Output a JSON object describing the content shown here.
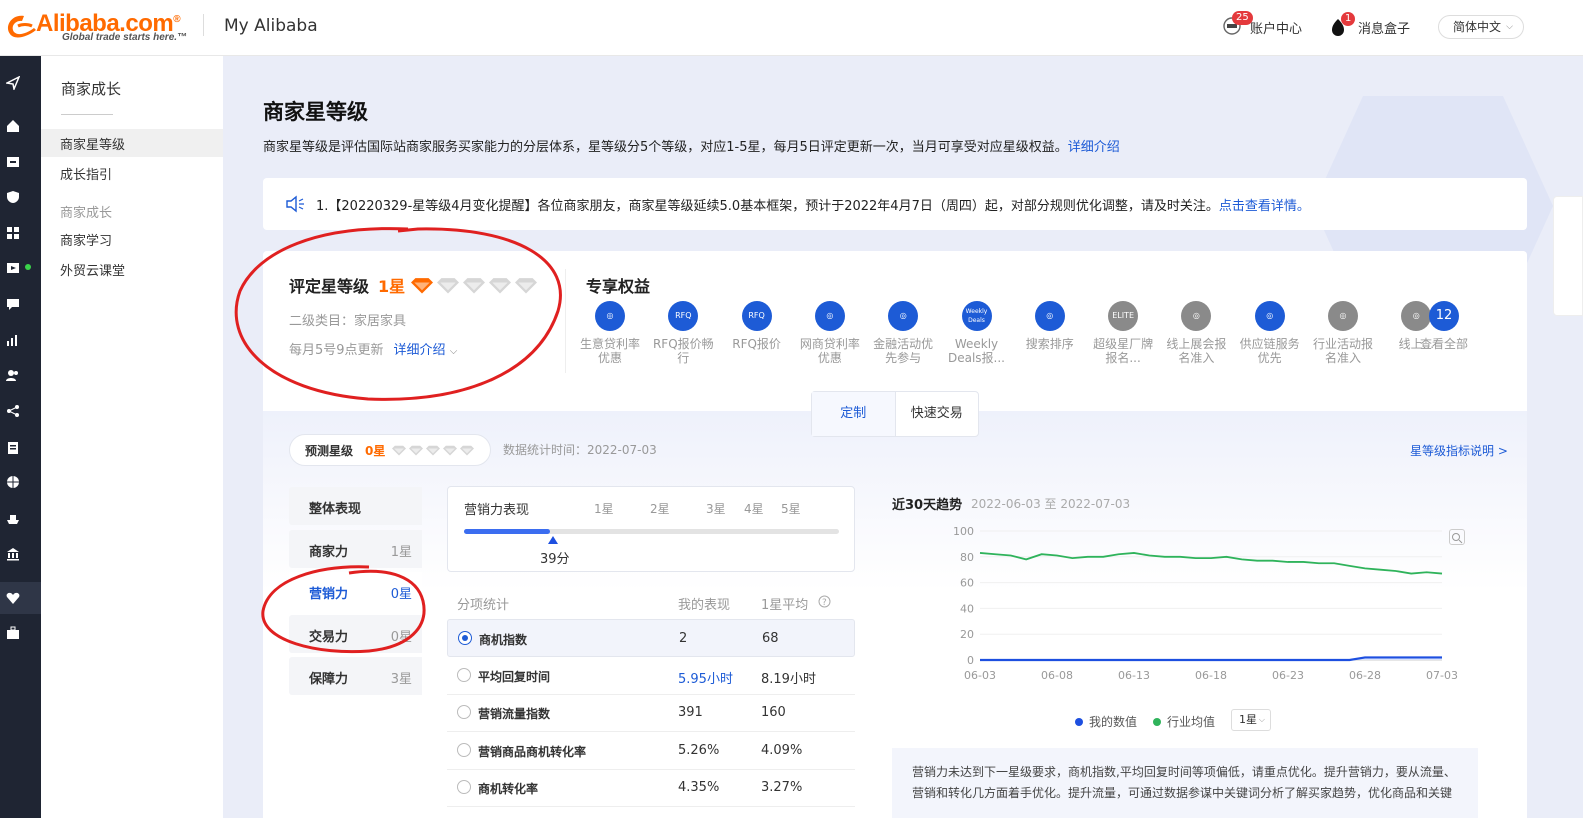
{
  "header": {
    "logo_text": "Alibaba.com",
    "logo_trademark": "®",
    "logo_tagline": "Global trade starts here.™",
    "site_title": "My Alibaba",
    "account_badge": "25",
    "account_label": "账户中心",
    "msg_badge": "1",
    "msg_label": "消息盒子",
    "language": "简体中文"
  },
  "sidebar": {
    "title": "商家成长",
    "items": [
      {
        "label": "商家星等级"
      },
      {
        "label": "成长指引"
      }
    ],
    "group": "商家成长",
    "group_items": [
      {
        "label": "商家学习"
      },
      {
        "label": "外贸云课堂"
      }
    ]
  },
  "page": {
    "title": "商家星等级",
    "desc": "商家星等级是评估国际站商家服务买家能力的分层体系，星等级分5个等级，对应1-5星，每月5日评定更新一次，当月可享受对应星级权益。",
    "desc_link": "详细介绍",
    "notice": "1.【20220329-星等级4月变化提醒】各位商家朋友，商家星等级延续5.0基本框架，预计于2022年4月7日（周四）起，对部分规则优化调整，请及时关注。",
    "notice_link": "点击查看详情。"
  },
  "level": {
    "title": "评定星等级",
    "value": "1星",
    "category": "二级类目：家居家具",
    "update": "每月5号9点更新",
    "detail_link": "详细介绍",
    "earned_diamonds": 1,
    "total_diamonds": 5
  },
  "benefits": {
    "title": "专享权益",
    "items": [
      {
        "label": "生意贷利率优惠",
        "icon": "hand-coin-icon",
        "active": true
      },
      {
        "label": "RFQ报价畅行",
        "icon": "rfq-icon",
        "active": true
      },
      {
        "label": "RFQ报价",
        "icon": "rfq-icon",
        "active": true
      },
      {
        "label": "网商贷利率优惠",
        "icon": "m-loan-icon",
        "active": true
      },
      {
        "label": "金融活动优先参与",
        "icon": "lifebuoy-icon",
        "active": true
      },
      {
        "label": "Weekly Deals报...",
        "icon": "weekly-deals-icon",
        "active": true
      },
      {
        "label": "搜索排序",
        "icon": "ranking-icon",
        "active": true
      },
      {
        "label": "超级星厂牌报名...",
        "icon": "elite-icon",
        "active": false
      },
      {
        "label": "线上展会报名准入",
        "icon": "building-icon",
        "active": false
      },
      {
        "label": "供应链服务优先",
        "icon": "globe-icon",
        "active": true
      },
      {
        "label": "行业活动报名准入",
        "icon": "flag-icon",
        "active": false
      },
      {
        "label": "线上...",
        "icon": "more-icon",
        "active": false
      }
    ],
    "all_count": "12",
    "all_label": "查看全部",
    "icon_text_rfq": "RFQ",
    "icon_text_weekly": "Weekly Deals",
    "icon_text_elite": "ELITE"
  },
  "tabs": [
    {
      "label": "定制"
    },
    {
      "label": "快速交易"
    }
  ],
  "predict": {
    "label": "预测星级",
    "value": "0星",
    "stat_time": "数据统计时间：2022-07-03",
    "explain_link": "星等级指标说明 >"
  },
  "dimensions": [
    {
      "name": "整体表现",
      "value": ""
    },
    {
      "name": "商家力",
      "value": "1星"
    },
    {
      "name": "营销力",
      "value": "0星"
    },
    {
      "name": "交易力",
      "value": "0星"
    },
    {
      "name": "保障力",
      "value": "3星"
    }
  ],
  "perf": {
    "title": "营销力表现",
    "marks": [
      "1星",
      "2星",
      "3星",
      "4星",
      "5星"
    ],
    "score": "39分",
    "progress": 0.23
  },
  "table": {
    "headers": [
      "分项统计",
      "我的表现",
      "1星平均"
    ],
    "rows": [
      {
        "name": "商机指数",
        "mine": "2",
        "avg": "68",
        "selected": true
      },
      {
        "name": "平均回复时间",
        "mine": "5.95小时",
        "avg": "8.19小时",
        "selected": false
      },
      {
        "name": "营销流量指数",
        "mine": "391",
        "avg": "160",
        "selected": false
      },
      {
        "name": "营销商品商机转化率",
        "mine": "5.26%",
        "avg": "4.09%",
        "selected": false
      },
      {
        "name": "商机转化率",
        "mine": "4.35%",
        "avg": "3.27%",
        "selected": false
      }
    ]
  },
  "trend": {
    "title": "近30天趋势",
    "range": "2022-06-03 至 2022-07-03",
    "legend_mine": "我的数值",
    "legend_ind": "行业均值",
    "select": "1星",
    "advice": "营销力未达到下一星级要求，商机指数,平均回复时间等项偏低，请重点优化。提升营销力，要从流量、营销和转化几方面着手优化。提升流量，可通过数据参谋中关键词分析了解买家趋势，优化商品和关键"
  },
  "chart_data": {
    "type": "line",
    "x": [
      "06-03",
      "06-04",
      "06-05",
      "06-06",
      "06-07",
      "06-08",
      "06-09",
      "06-10",
      "06-11",
      "06-12",
      "06-13",
      "06-14",
      "06-15",
      "06-16",
      "06-17",
      "06-18",
      "06-19",
      "06-20",
      "06-21",
      "06-22",
      "06-23",
      "06-24",
      "06-25",
      "06-26",
      "06-27",
      "06-28",
      "06-29",
      "06-30",
      "07-01",
      "07-02",
      "07-03"
    ],
    "xticks": [
      "06-03",
      "06-08",
      "06-13",
      "06-18",
      "06-23",
      "06-28",
      "07-03"
    ],
    "yticks": [
      "0",
      "20",
      "40",
      "60",
      "80",
      "100"
    ],
    "ylim": [
      0,
      100
    ],
    "series": [
      {
        "name": "行业均值",
        "color": "#2fb35b",
        "values": [
          83,
          82,
          81,
          78,
          82,
          81,
          79,
          80,
          80,
          82,
          83,
          81,
          80,
          80,
          79,
          79,
          80,
          78,
          77,
          77,
          76,
          76,
          75,
          75,
          73,
          71,
          70,
          69,
          67,
          68,
          67
        ]
      },
      {
        "name": "我的数值",
        "color": "#1d4fe0",
        "values": [
          0,
          0,
          0,
          0,
          0,
          0,
          0,
          0,
          0,
          0,
          0,
          0,
          0,
          0,
          0,
          0,
          0,
          0,
          0,
          0,
          0,
          0,
          0,
          0,
          0,
          2,
          2,
          2,
          2,
          2,
          2
        ]
      }
    ]
  }
}
